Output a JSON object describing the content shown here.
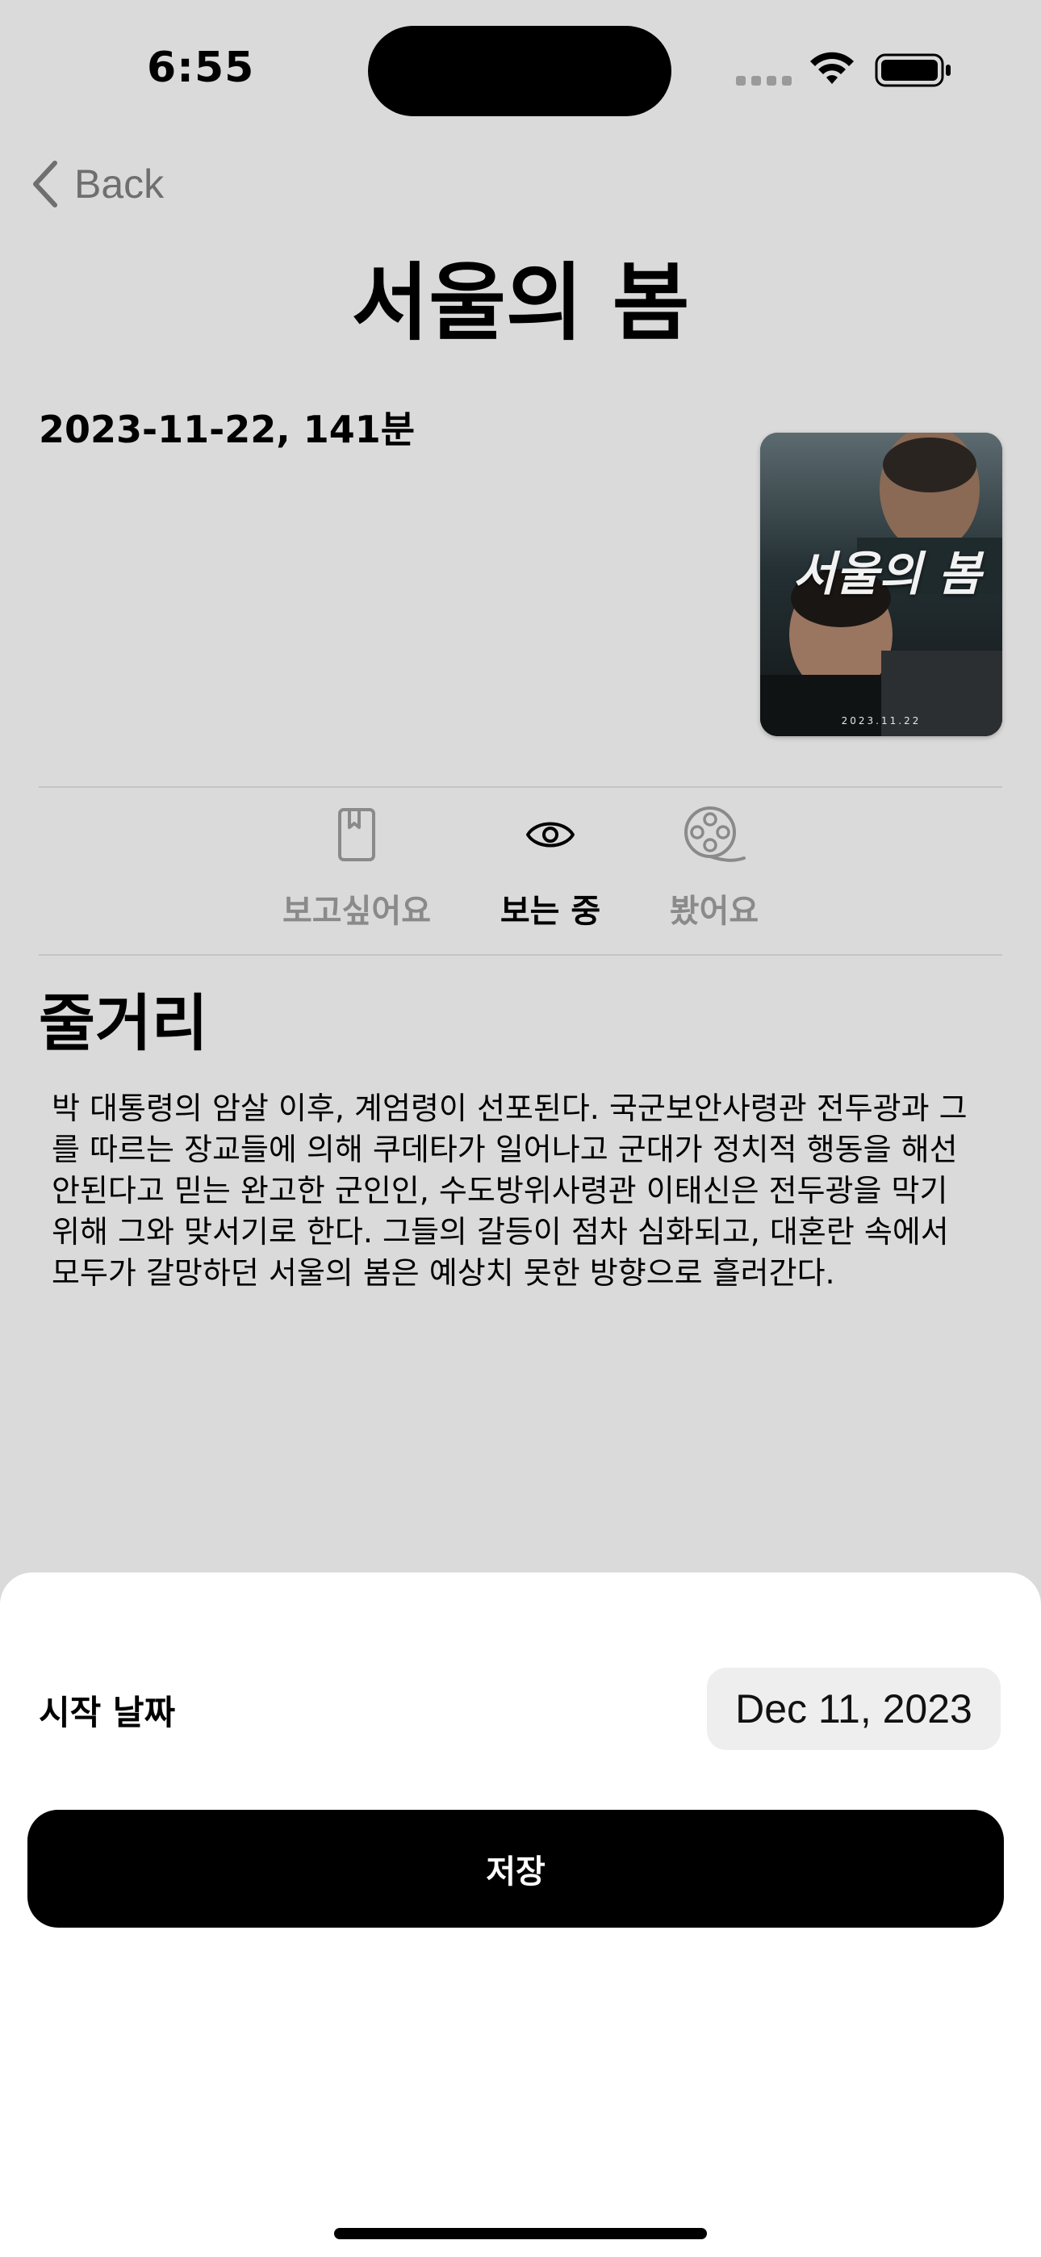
{
  "status_bar": {
    "time": "6:55"
  },
  "nav": {
    "back_label": "Back"
  },
  "movie": {
    "title": "서울의 봄",
    "meta": "2023-11-22, 141분",
    "poster_title": "서울의 봄",
    "poster_date": "2023.11.22"
  },
  "watch_status": {
    "tabs": [
      {
        "label": "보고싶어요",
        "icon": "bookmark-icon",
        "active": false
      },
      {
        "label": "보는 중",
        "icon": "eye-icon",
        "active": true
      },
      {
        "label": "봤어요",
        "icon": "film-reel-icon",
        "active": false
      }
    ]
  },
  "synopsis": {
    "heading": "줄거리",
    "text": "박 대통령의 암살 이후, 계엄령이 선포된다. 국군보안사령관 전두광과 그를 따르는 장교들에 의해 쿠데타가 일어나고 군대가 정치적 행동을 해선 안된다고 믿는 완고한 군인인, 수도방위사령관 이태신은 전두광을 막기 위해 그와 맞서기로 한다. 그들의 갈등이 점차 심화되고, 대혼란 속에서 모두가 갈망하던 서울의 봄은 예상치 못한 방향으로 흘러간다."
  },
  "sheet": {
    "start_date_label": "시작 날짜",
    "start_date_value": "Dec 11, 2023",
    "save_label": "저장"
  },
  "colors": {
    "background": "#dadada",
    "sheet": "#ffffff",
    "primary_button": "#000000",
    "muted_text": "#8a8a8a"
  }
}
